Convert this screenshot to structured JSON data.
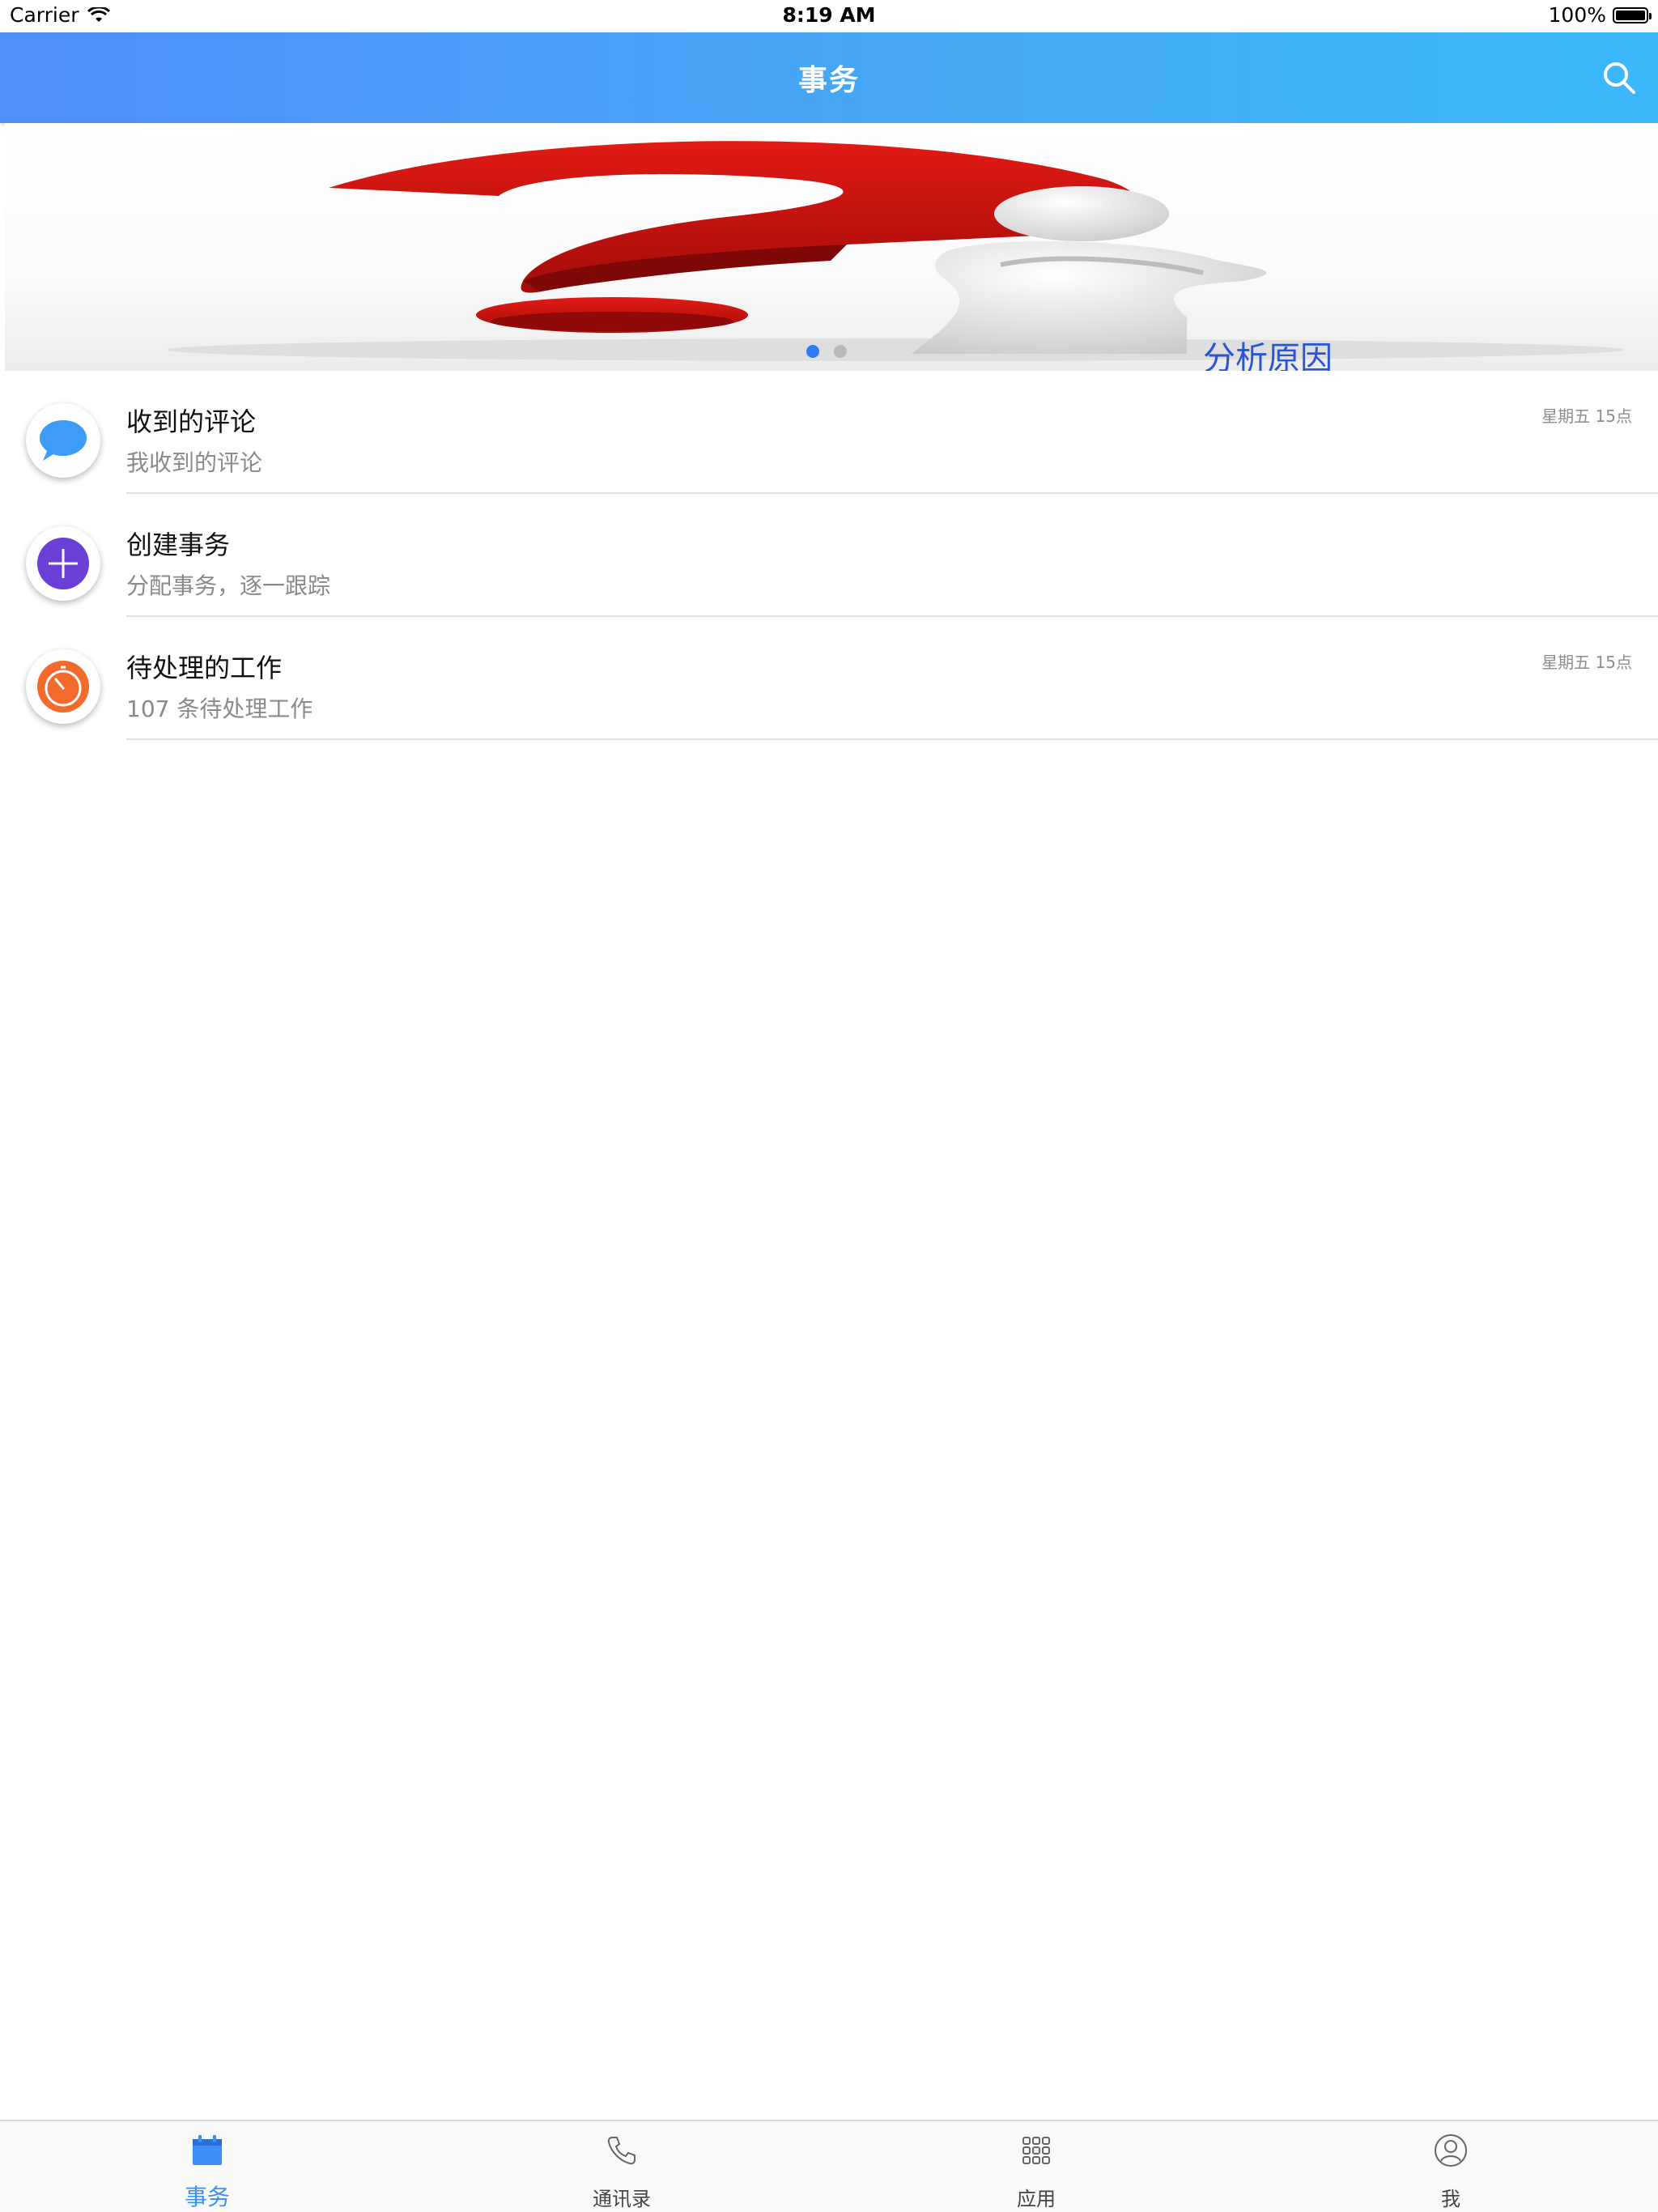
{
  "status_bar": {
    "carrier": "Carrier",
    "time": "8:19 AM",
    "battery": "100%"
  },
  "nav": {
    "title": "事务",
    "search_icon": "search-icon"
  },
  "banner": {
    "caption": "分析原因",
    "page_count": 2,
    "active_page": 1
  },
  "list": [
    {
      "title": "收到的评论",
      "subtitle": "我收到的评论",
      "time": "星期五 15点",
      "icon": "comment-bubble-icon",
      "icon_color": "#3c9cf6"
    },
    {
      "title": "创建事务",
      "subtitle": "分配事务，逐一跟踪",
      "time": "",
      "icon": "plus-icon",
      "icon_color": "#6a3fd6"
    },
    {
      "title": "待处理的工作",
      "subtitle": "107 条待处理工作",
      "time": "星期五 15点",
      "icon": "timer-icon",
      "icon_color": "#f26a2c"
    }
  ],
  "tabs": [
    {
      "label": "事务",
      "icon": "calendar-icon",
      "active": true
    },
    {
      "label": "通讯录",
      "icon": "phone-icon",
      "active": false
    },
    {
      "label": "应用",
      "icon": "grid-icon",
      "active": false
    },
    {
      "label": "我",
      "icon": "user-icon",
      "active": false
    }
  ],
  "colors": {
    "accent": "#3d8ef7",
    "nav_gradient_start": "#4f8ff8",
    "nav_gradient_end": "#3bb8fb"
  }
}
